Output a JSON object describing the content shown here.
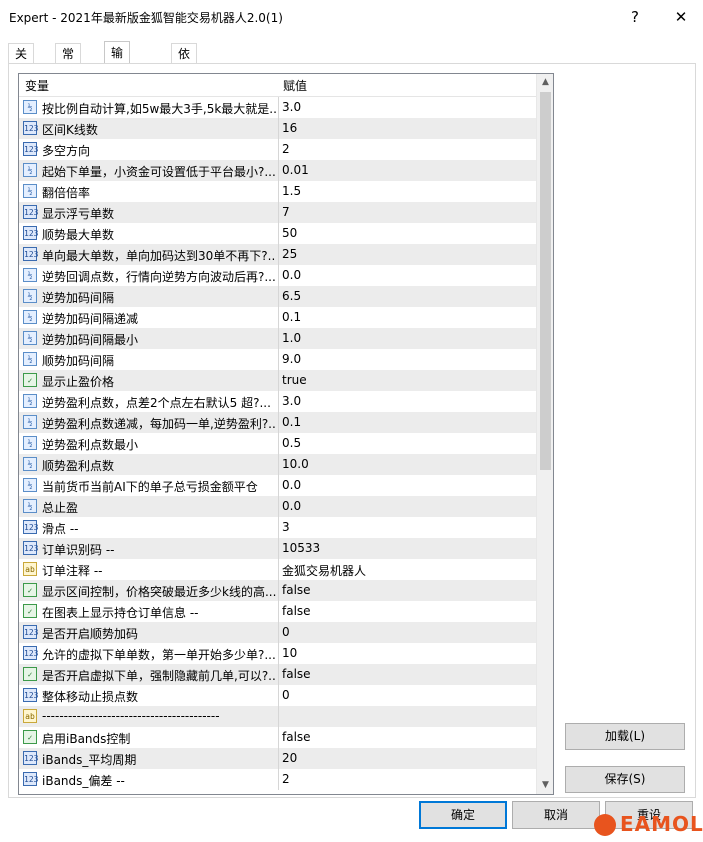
{
  "window": {
    "title": "Expert - 2021年最新版金狐智能交易机器人2.0(1)",
    "help_glyph": "?",
    "close_glyph": "✕"
  },
  "tabs": [
    {
      "label": "关于"
    },
    {
      "label": "常用"
    },
    {
      "label": "输入参数"
    },
    {
      "label": "依存关系"
    }
  ],
  "grid": {
    "col_variable": "变量",
    "col_value": "赋值",
    "rows": [
      {
        "icon": "double",
        "icon_text": "½",
        "name": "按比例自动计算,如5w最大3手,5k最大就是...",
        "value": "3.0"
      },
      {
        "icon": "int",
        "icon_text": "123",
        "name": "区间K线数",
        "value": "16"
      },
      {
        "icon": "int",
        "icon_text": "123",
        "name": "多空方向",
        "value": "2"
      },
      {
        "icon": "double",
        "icon_text": "½",
        "name": "起始下单量，小资金可设置低于平台最小?...",
        "value": "0.01"
      },
      {
        "icon": "double",
        "icon_text": "½",
        "name": "翻倍倍率",
        "value": "1.5"
      },
      {
        "icon": "int",
        "icon_text": "123",
        "name": "显示浮亏单数",
        "value": "7"
      },
      {
        "icon": "int",
        "icon_text": "123",
        "name": "顺势最大单数",
        "value": "50"
      },
      {
        "icon": "int",
        "icon_text": "123",
        "name": "单向最大单数，单向加码达到30单不再下?...",
        "value": "25"
      },
      {
        "icon": "double",
        "icon_text": "½",
        "name": "逆势回调点数，行情向逆势方向波动后再?...",
        "value": "0.0"
      },
      {
        "icon": "double",
        "icon_text": "½",
        "name": "逆势加码间隔",
        "value": "6.5"
      },
      {
        "icon": "double",
        "icon_text": "½",
        "name": "逆势加码间隔递减",
        "value": "0.1"
      },
      {
        "icon": "double",
        "icon_text": "½",
        "name": "逆势加码间隔最小",
        "value": "1.0"
      },
      {
        "icon": "double",
        "icon_text": "½",
        "name": "顺势加码间隔",
        "value": "9.0"
      },
      {
        "icon": "bool",
        "icon_text": "✓",
        "name": "显示止盈价格",
        "value": "true"
      },
      {
        "icon": "double",
        "icon_text": "½",
        "name": "逆势盈利点数，点差2个点左右默认5  超?...",
        "value": "3.0"
      },
      {
        "icon": "double",
        "icon_text": "½",
        "name": "逆势盈利点数递减，每加码一单,逆势盈利?...",
        "value": "0.1"
      },
      {
        "icon": "double",
        "icon_text": "½",
        "name": "逆势盈利点数最小",
        "value": "0.5"
      },
      {
        "icon": "double",
        "icon_text": "½",
        "name": "顺势盈利点数",
        "value": "10.0"
      },
      {
        "icon": "double",
        "icon_text": "½",
        "name": "当前货币当前AI下的单子总亏损金额平仓",
        "value": "0.0"
      },
      {
        "icon": "double",
        "icon_text": "½",
        "name": "总止盈",
        "value": "0.0"
      },
      {
        "icon": "int",
        "icon_text": "123",
        "name": "滑点 --",
        "value": "3"
      },
      {
        "icon": "int",
        "icon_text": "123",
        "name": "订单识别码 --",
        "value": "10533"
      },
      {
        "icon": "text",
        "icon_text": "ab",
        "name": "订单注释 --",
        "value": "金狐交易机器人"
      },
      {
        "icon": "bool",
        "icon_text": "✓",
        "name": "显示区间控制，价格突破最近多少k线的高...",
        "value": "false"
      },
      {
        "icon": "bool",
        "icon_text": "✓",
        "name": "在图表上显示持仓订单信息 --",
        "value": "false"
      },
      {
        "icon": "int",
        "icon_text": "123",
        "name": "是否开启顺势加码",
        "value": "0"
      },
      {
        "icon": "int",
        "icon_text": "123",
        "name": "允许的虚拟下单单数，第一单开始多少单?...",
        "value": "10"
      },
      {
        "icon": "bool",
        "icon_text": "✓",
        "name": "是否开启虚拟下单，强制隐藏前几单,可以?...",
        "value": "false"
      },
      {
        "icon": "int",
        "icon_text": "123",
        "name": "整体移动止损点数",
        "value": "0"
      },
      {
        "icon": "text",
        "icon_text": "ab",
        "name": "-----------------------------------------",
        "value": ""
      },
      {
        "icon": "bool",
        "icon_text": "✓",
        "name": "启用iBands控制",
        "value": "false"
      },
      {
        "icon": "int",
        "icon_text": "123",
        "name": "iBands_平均周期",
        "value": "20"
      },
      {
        "icon": "int",
        "icon_text": "123",
        "name": "iBands_偏差 --",
        "value": "2"
      }
    ]
  },
  "side_buttons": {
    "load": "加载(L)",
    "save": "保存(S)"
  },
  "footer": {
    "ok": "确定",
    "cancel": "取消",
    "reset": "重设"
  },
  "watermark": {
    "text": "EAMOL"
  },
  "scrollbar": {
    "up_glyph": "▲",
    "down_glyph": "▼"
  }
}
